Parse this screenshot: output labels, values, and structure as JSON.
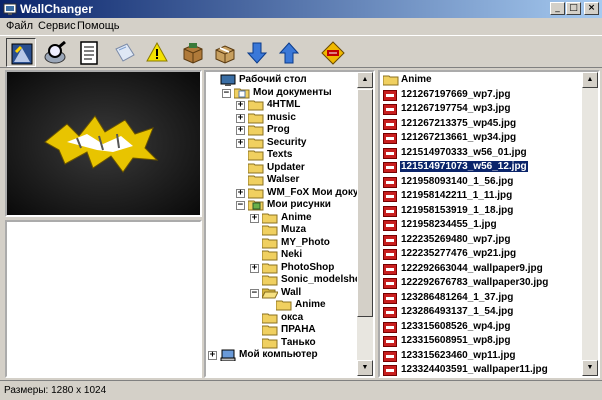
{
  "window": {
    "title": "WallChanger"
  },
  "menu": [
    "Файл",
    "Сервис",
    "Помощь"
  ],
  "toolbar": {
    "buttons": [
      {
        "name": "wallpaper-set-button",
        "icon": "monitor-icon"
      },
      {
        "name": "search-button",
        "icon": "magnifier-icon"
      },
      {
        "name": "list-button",
        "icon": "document-icon"
      },
      {
        "name": "edit-button",
        "icon": "paper-icon"
      },
      {
        "name": "hint-button",
        "icon": "lightbulb-icon"
      },
      {
        "name": "package-button",
        "icon": "box-icon"
      },
      {
        "name": "archive-button",
        "icon": "parcel-icon"
      },
      {
        "name": "move-down-button",
        "icon": "arrow-down-icon"
      },
      {
        "name": "move-up-button",
        "icon": "arrow-up-icon"
      },
      {
        "name": "exit-button",
        "icon": "exit-icon"
      }
    ]
  },
  "tree": [
    {
      "label": "Рабочий стол",
      "level": 0,
      "expander": "",
      "type": "desktop"
    },
    {
      "label": "Мои документы",
      "level": 1,
      "expander": "−",
      "type": "mydocs"
    },
    {
      "label": "4HTML",
      "level": 2,
      "expander": "+",
      "type": "folder"
    },
    {
      "label": "music",
      "level": 2,
      "expander": "+",
      "type": "folder"
    },
    {
      "label": "Prog",
      "level": 2,
      "expander": "+",
      "type": "folder"
    },
    {
      "label": "Security",
      "level": 2,
      "expander": "+",
      "type": "folder"
    },
    {
      "label": "Texts",
      "level": 2,
      "expander": "",
      "type": "folder"
    },
    {
      "label": "Updater",
      "level": 2,
      "expander": "",
      "type": "folder"
    },
    {
      "label": "Walser",
      "level": 2,
      "expander": "",
      "type": "folder"
    },
    {
      "label": "WM_FoX Мои докумен",
      "level": 2,
      "expander": "+",
      "type": "folder"
    },
    {
      "label": "Мои рисунки",
      "level": 2,
      "expander": "−",
      "type": "pictures"
    },
    {
      "label": "Anime",
      "level": 3,
      "expander": "+",
      "type": "folder"
    },
    {
      "label": "Muza",
      "level": 3,
      "expander": "",
      "type": "folder"
    },
    {
      "label": "MY_Photo",
      "level": 3,
      "expander": "",
      "type": "folder"
    },
    {
      "label": "Neki",
      "level": 3,
      "expander": "",
      "type": "folder"
    },
    {
      "label": "PhotoShop",
      "level": 3,
      "expander": "+",
      "type": "folder"
    },
    {
      "label": "Sonic_modelsheets",
      "level": 3,
      "expander": "",
      "type": "folder"
    },
    {
      "label": "Wall",
      "level": 3,
      "expander": "−",
      "type": "folder-open"
    },
    {
      "label": "Anime",
      "level": 4,
      "expander": "",
      "type": "folder"
    },
    {
      "label": "окса",
      "level": 3,
      "expander": "",
      "type": "folder"
    },
    {
      "label": "ПРАНА",
      "level": 3,
      "expander": "",
      "type": "folder"
    },
    {
      "label": "Танько",
      "level": 3,
      "expander": "",
      "type": "folder"
    },
    {
      "label": "Мой компьютер",
      "level": 0,
      "expander": "+",
      "type": "computer"
    }
  ],
  "files": {
    "folder": "Anime",
    "items": [
      "121267197669_wp7.jpg",
      "121267197754_wp3.jpg",
      "121267213375_wp45.jpg",
      "121267213661_wp34.jpg",
      "121514970333_w56_01.jpg",
      "121514971073_w56_12.jpg",
      "121958093140_1_56.jpg",
      "121958142211_1_11.jpg",
      "121958153919_1_18.jpg",
      "121958234455_1.jpg",
      "122235269480_wp7.jpg",
      "122235277476_wp21.jpg",
      "122292663044_wallpaper9.jpg",
      "122292676783_wallpaper30.jpg",
      "123286481264_1_37.jpg",
      "123286493137_1_54.jpg",
      "123315608526_wp4.jpg",
      "123315608951_wp8.jpg",
      "123315623460_wp11.jpg",
      "123324403591_wallpaper11.jpg"
    ],
    "selected_index": 5
  },
  "status": {
    "text": "Размеры: 1280 x 1024"
  }
}
